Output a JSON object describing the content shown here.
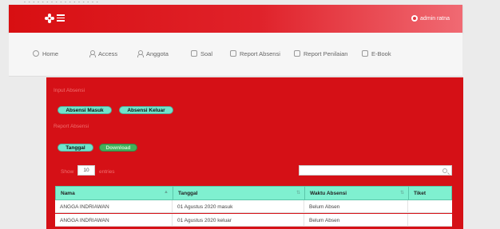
{
  "topbar": {
    "text": "- - - - - - - - - - - - - - - - -"
  },
  "header": {
    "user_label": "admin ratna"
  },
  "nav": {
    "items": [
      {
        "label": "Home",
        "icon": "home-icon"
      },
      {
        "label": "Access",
        "icon": "user-icon"
      },
      {
        "label": "Anggota",
        "icon": "user-icon"
      },
      {
        "label": "Soal",
        "icon": "file-icon"
      },
      {
        "label": "Report Absensi",
        "icon": "file-icon"
      },
      {
        "label": "Report Penilaian",
        "icon": "file-icon"
      },
      {
        "label": "E-Book",
        "icon": "file-icon"
      }
    ]
  },
  "panel": {
    "section1_label": "Input Absensi",
    "absensi_masuk": "Absensi Masuk",
    "absensi_keluar": "Absensi Keluar",
    "section2_label": "Report Absensi",
    "tanggal": "Tanggal",
    "download": "Download",
    "show_label": "Show",
    "entries_value": "10",
    "entries_label": "entries",
    "search_value": ""
  },
  "table": {
    "headers": [
      "Nama",
      "Tanggal",
      "Waktu Absensi",
      "Tiket"
    ],
    "rows": [
      [
        "ANGGA INDRIAWAN",
        "01 Agustus 2020 masuk",
        "Belum Absen",
        ""
      ],
      [
        "ANGGA INDRIAWAN",
        "01 Agustus 2020 keluar",
        "Belum Absen",
        ""
      ]
    ]
  },
  "colors": {
    "header_red": "#d80f12",
    "panel_red": "#d51016",
    "teal": "#6fe5cc",
    "green": "#43b05a",
    "table_header": "#7ff0d0"
  }
}
